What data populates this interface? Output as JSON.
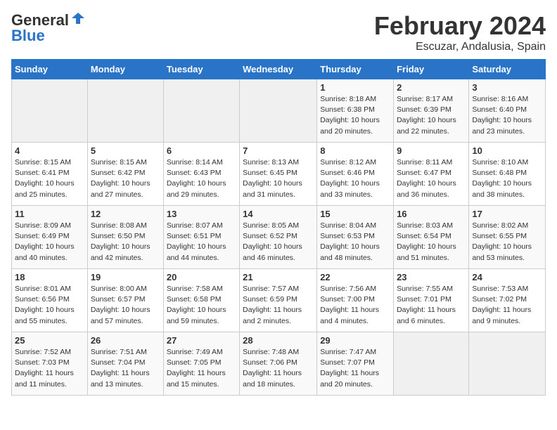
{
  "logo": {
    "general": "General",
    "blue": "Blue"
  },
  "title": {
    "month_year": "February 2024",
    "location": "Escuzar, Andalusia, Spain"
  },
  "weekdays": [
    "Sunday",
    "Monday",
    "Tuesday",
    "Wednesday",
    "Thursday",
    "Friday",
    "Saturday"
  ],
  "weeks": [
    [
      {
        "day": "",
        "info": ""
      },
      {
        "day": "",
        "info": ""
      },
      {
        "day": "",
        "info": ""
      },
      {
        "day": "",
        "info": ""
      },
      {
        "day": "1",
        "info": "Sunrise: 8:18 AM\nSunset: 6:38 PM\nDaylight: 10 hours\nand 20 minutes."
      },
      {
        "day": "2",
        "info": "Sunrise: 8:17 AM\nSunset: 6:39 PM\nDaylight: 10 hours\nand 22 minutes."
      },
      {
        "day": "3",
        "info": "Sunrise: 8:16 AM\nSunset: 6:40 PM\nDaylight: 10 hours\nand 23 minutes."
      }
    ],
    [
      {
        "day": "4",
        "info": "Sunrise: 8:15 AM\nSunset: 6:41 PM\nDaylight: 10 hours\nand 25 minutes."
      },
      {
        "day": "5",
        "info": "Sunrise: 8:15 AM\nSunset: 6:42 PM\nDaylight: 10 hours\nand 27 minutes."
      },
      {
        "day": "6",
        "info": "Sunrise: 8:14 AM\nSunset: 6:43 PM\nDaylight: 10 hours\nand 29 minutes."
      },
      {
        "day": "7",
        "info": "Sunrise: 8:13 AM\nSunset: 6:45 PM\nDaylight: 10 hours\nand 31 minutes."
      },
      {
        "day": "8",
        "info": "Sunrise: 8:12 AM\nSunset: 6:46 PM\nDaylight: 10 hours\nand 33 minutes."
      },
      {
        "day": "9",
        "info": "Sunrise: 8:11 AM\nSunset: 6:47 PM\nDaylight: 10 hours\nand 36 minutes."
      },
      {
        "day": "10",
        "info": "Sunrise: 8:10 AM\nSunset: 6:48 PM\nDaylight: 10 hours\nand 38 minutes."
      }
    ],
    [
      {
        "day": "11",
        "info": "Sunrise: 8:09 AM\nSunset: 6:49 PM\nDaylight: 10 hours\nand 40 minutes."
      },
      {
        "day": "12",
        "info": "Sunrise: 8:08 AM\nSunset: 6:50 PM\nDaylight: 10 hours\nand 42 minutes."
      },
      {
        "day": "13",
        "info": "Sunrise: 8:07 AM\nSunset: 6:51 PM\nDaylight: 10 hours\nand 44 minutes."
      },
      {
        "day": "14",
        "info": "Sunrise: 8:05 AM\nSunset: 6:52 PM\nDaylight: 10 hours\nand 46 minutes."
      },
      {
        "day": "15",
        "info": "Sunrise: 8:04 AM\nSunset: 6:53 PM\nDaylight: 10 hours\nand 48 minutes."
      },
      {
        "day": "16",
        "info": "Sunrise: 8:03 AM\nSunset: 6:54 PM\nDaylight: 10 hours\nand 51 minutes."
      },
      {
        "day": "17",
        "info": "Sunrise: 8:02 AM\nSunset: 6:55 PM\nDaylight: 10 hours\nand 53 minutes."
      }
    ],
    [
      {
        "day": "18",
        "info": "Sunrise: 8:01 AM\nSunset: 6:56 PM\nDaylight: 10 hours\nand 55 minutes."
      },
      {
        "day": "19",
        "info": "Sunrise: 8:00 AM\nSunset: 6:57 PM\nDaylight: 10 hours\nand 57 minutes."
      },
      {
        "day": "20",
        "info": "Sunrise: 7:58 AM\nSunset: 6:58 PM\nDaylight: 10 hours\nand 59 minutes."
      },
      {
        "day": "21",
        "info": "Sunrise: 7:57 AM\nSunset: 6:59 PM\nDaylight: 11 hours\nand 2 minutes."
      },
      {
        "day": "22",
        "info": "Sunrise: 7:56 AM\nSunset: 7:00 PM\nDaylight: 11 hours\nand 4 minutes."
      },
      {
        "day": "23",
        "info": "Sunrise: 7:55 AM\nSunset: 7:01 PM\nDaylight: 11 hours\nand 6 minutes."
      },
      {
        "day": "24",
        "info": "Sunrise: 7:53 AM\nSunset: 7:02 PM\nDaylight: 11 hours\nand 9 minutes."
      }
    ],
    [
      {
        "day": "25",
        "info": "Sunrise: 7:52 AM\nSunset: 7:03 PM\nDaylight: 11 hours\nand 11 minutes."
      },
      {
        "day": "26",
        "info": "Sunrise: 7:51 AM\nSunset: 7:04 PM\nDaylight: 11 hours\nand 13 minutes."
      },
      {
        "day": "27",
        "info": "Sunrise: 7:49 AM\nSunset: 7:05 PM\nDaylight: 11 hours\nand 15 minutes."
      },
      {
        "day": "28",
        "info": "Sunrise: 7:48 AM\nSunset: 7:06 PM\nDaylight: 11 hours\nand 18 minutes."
      },
      {
        "day": "29",
        "info": "Sunrise: 7:47 AM\nSunset: 7:07 PM\nDaylight: 11 hours\nand 20 minutes."
      },
      {
        "day": "",
        "info": ""
      },
      {
        "day": "",
        "info": ""
      }
    ]
  ]
}
